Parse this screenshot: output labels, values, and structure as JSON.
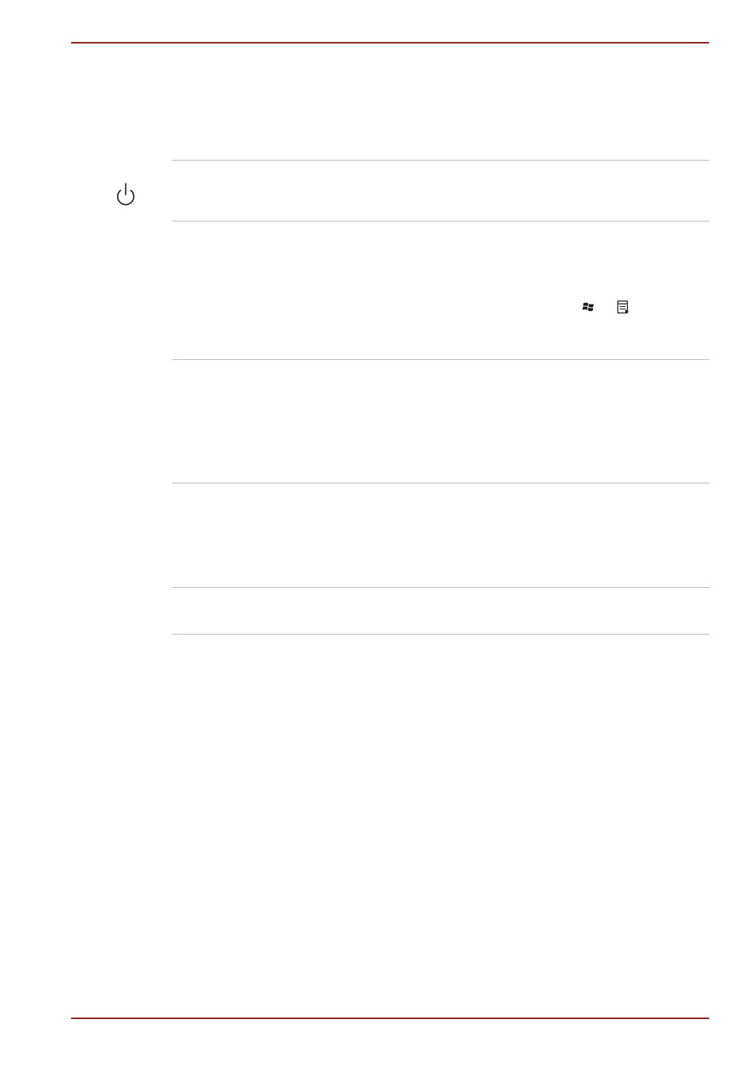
{
  "document": {
    "accent_color": "#8e2525",
    "divider_color": "#bdbdbd"
  },
  "table": {
    "rows": [
      {
        "icon": "power-icon"
      },
      {
        "icons": [
          "windows-logo-icon",
          "application-menu-icon"
        ]
      },
      {},
      {},
      {}
    ]
  }
}
